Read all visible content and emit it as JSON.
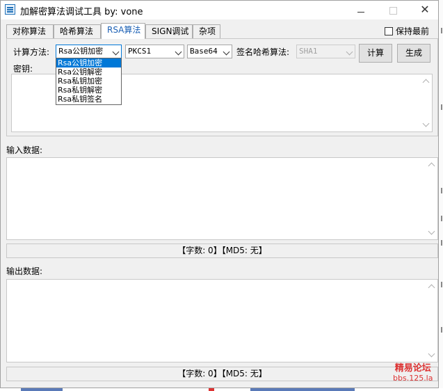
{
  "window": {
    "title": "加解密算法调试工具  by: vone"
  },
  "tabs": [
    {
      "label": "对称算法"
    },
    {
      "label": "哈希算法"
    },
    {
      "label": "RSA算法"
    },
    {
      "label": "SIGN调试"
    },
    {
      "label": "杂项"
    }
  ],
  "keep_on_top": {
    "label": "保持最前",
    "checked": false
  },
  "rsa": {
    "method_label": "计算方法:",
    "method_value": "Rsa公钥加密",
    "method_options": [
      "Rsa公钥加密",
      "Rsa公钥解密",
      "Rsa私钥加密",
      "Rsa私钥解密",
      "Rsa私钥签名"
    ],
    "padding_value": "PKCS1",
    "encoding_value": "Base64",
    "sign_hash_label": "签名哈希算法:",
    "sign_hash_value": "SHA1",
    "compute_button": "计算",
    "generate_button": "生成",
    "key_label": "密钥:"
  },
  "input": {
    "label": "输入数据:",
    "status": "【字数: 0】【MD5: 无】"
  },
  "output": {
    "label": "输出数据:",
    "status": "【字数: 0】【MD5: 无】"
  },
  "watermark": {
    "line1": "精易论坛",
    "line2": "bbs.125.la"
  },
  "colors": {
    "accent": "#0078d7",
    "active_tab_text": "#1a5fb4",
    "watermark": "#dd3333"
  }
}
